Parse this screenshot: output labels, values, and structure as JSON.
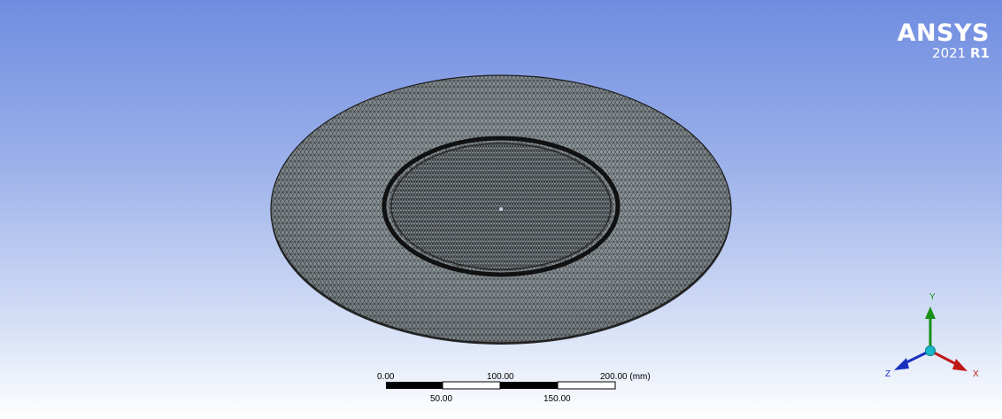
{
  "logo": {
    "brand": "ANSYS",
    "year": "2021",
    "release": "R1"
  },
  "scale_bar": {
    "top_labels": [
      "0.00",
      "100.00",
      "200.00 (mm)"
    ],
    "bottom_labels": [
      "50.00",
      "150.00"
    ]
  },
  "triad": {
    "x_label": "X",
    "y_label": "Y",
    "z_label": "Z",
    "colors": {
      "x": "#c01818",
      "y": "#189018",
      "z": "#1830c0",
      "center": "#18b8c8"
    }
  },
  "model": {
    "mesh_color": "#8f9aa0",
    "edge_color": "#1c1c1c"
  }
}
